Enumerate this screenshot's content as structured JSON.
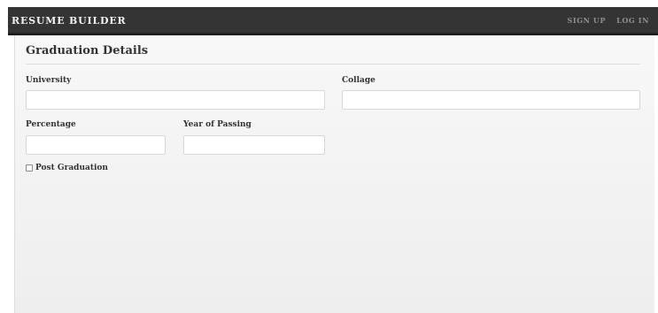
{
  "navbar": {
    "brand": "RESUME BUILDER",
    "links": [
      "SIGN UP",
      "LOG IN"
    ]
  },
  "graduation": {
    "title": "Graduation Details",
    "fields": {
      "university": {
        "label": "University",
        "value": ""
      },
      "collage": {
        "label": "Collage",
        "value": ""
      },
      "percentage": {
        "label": "Percentage",
        "value": ""
      },
      "year_of_passing": {
        "label": "Year of Passing",
        "value": ""
      }
    },
    "post_graduation": {
      "label": "Post Graduation",
      "checked": false
    }
  },
  "colors": {
    "navbar_bg": "#343434",
    "brand_text": "#f2f2f2",
    "nav_link_text": "#8f8f8f",
    "panel_bg": "#f4f4f4"
  }
}
